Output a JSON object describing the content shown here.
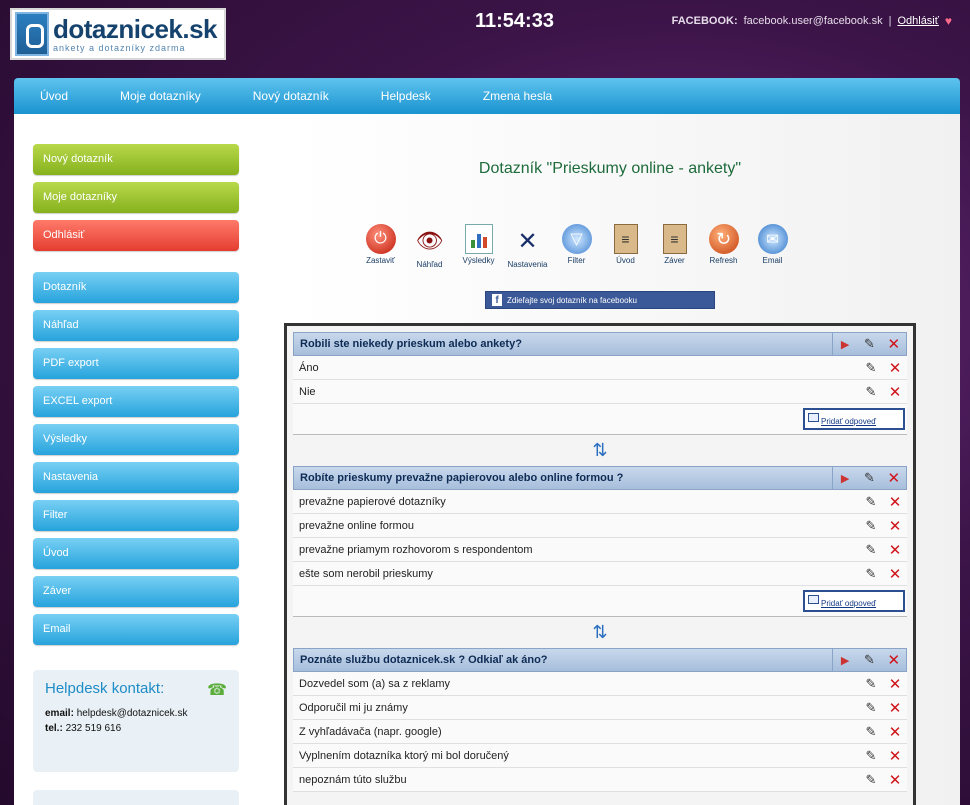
{
  "header": {
    "logo_name": "dotaznicek.sk",
    "logo_sub": "ankety a dotazníky zdarma",
    "clock": "11:54:33",
    "user_prefix": "FACEBOOK:",
    "user_email": "facebook.user@facebook.sk",
    "logout": "Odhlásiť"
  },
  "nav": {
    "items": [
      "Úvod",
      "Moje dotazníky",
      "Nový dotazník",
      "Helpdesk",
      "Zmena hesla"
    ]
  },
  "sidebar": {
    "top": [
      "Nový dotazník",
      "Moje dotazníky"
    ],
    "logout": "Odhlásiť",
    "items": [
      "Dotazník",
      "Náhľad",
      "PDF export",
      "EXCEL export",
      "Výsledky",
      "Nastavenia",
      "Filter",
      "Úvod",
      "Záver",
      "Email"
    ]
  },
  "help": {
    "title": "Helpdesk kontakt:",
    "email_label": "email:",
    "email": "helpdesk@dotaznicek.sk",
    "tel_label": "tel.:",
    "tel": "232 519 616"
  },
  "content": {
    "title": "Dotazník \"Prieskumy online - ankety\"",
    "tools": [
      "Zastaviť",
      "Náhľad",
      "Výsledky",
      "Nastavenia",
      "Filter",
      "Úvod",
      "Záver",
      "Refresh",
      "Email"
    ],
    "share": "Zdieľajte svoj dotazník na facebooku",
    "add_answer": "Pridať odpoveď",
    "questions": [
      {
        "q": "Robili ste niekedy prieskum alebo ankety?",
        "answers": [
          "Áno",
          "Nie"
        ]
      },
      {
        "q": "Robíte prieskumy prevažne papierovou alebo online formou ?",
        "answers": [
          "prevažne papierové dotazníky",
          "prevažne online formou",
          "prevažne priamym rozhovorom s respondentom",
          "ešte som nerobil prieskumy"
        ]
      },
      {
        "q": "Poznáte službu dotaznicek.sk ? Odkiaľ ak áno?",
        "answers": [
          "Dozvedel som (a) sa z reklamy",
          "Odporučil mi ju známy",
          "Z vyhľadávača (napr. google)",
          "Vyplnením dotazníka ktorý mi bol doručený",
          "nepoznám túto službu"
        ]
      }
    ]
  }
}
